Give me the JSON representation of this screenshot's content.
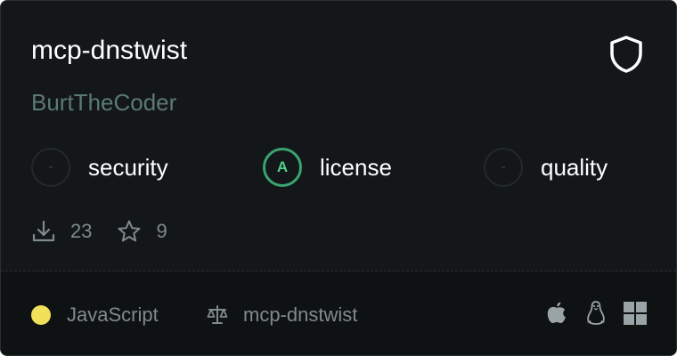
{
  "server": {
    "name": "mcp-dnstwist",
    "author": "BurtTheCoder",
    "badge_icon": "shield-icon"
  },
  "metrics": [
    {
      "grade": "-",
      "label": "security"
    },
    {
      "grade": "A",
      "label": "license"
    },
    {
      "grade": "-",
      "label": "quality"
    }
  ],
  "stats": {
    "downloads": "23",
    "stars": "9"
  },
  "footer": {
    "language": "JavaScript",
    "language_color": "#f1e05a",
    "license": "mcp-dnstwist",
    "platforms": [
      "apple-icon",
      "linux-icon",
      "windows-icon"
    ]
  },
  "colors": {
    "card_background": "#131719",
    "footer_background": "#0f1213",
    "grade_good": "#3aa46e",
    "author_text": "#5b7a72"
  }
}
